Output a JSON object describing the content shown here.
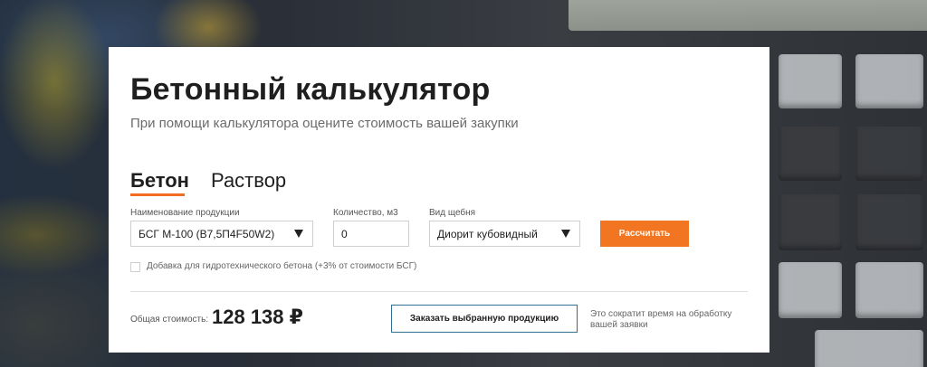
{
  "page": {
    "title": "Бетонный калькулятор",
    "subtitle": "При помощи калькулятора оцените стоимость вашей закупки"
  },
  "tabs": [
    {
      "label": "Бетон",
      "active": true
    },
    {
      "label": "Раствор",
      "active": false
    }
  ],
  "form": {
    "product": {
      "label": "Наименование продукции",
      "value": "БСГ М-100 (В7,5П4F50W2)"
    },
    "quantity": {
      "label": "Количество, м3",
      "value": "0"
    },
    "gravel": {
      "label": "Вид щебня",
      "value": "Диорит кубовидный"
    },
    "calculate_label": "Рассчитать",
    "additive": {
      "label": "Добавка для гидротехнического бетона (+3% от стоимости БСГ)",
      "checked": false
    }
  },
  "summary": {
    "total_label": "Общая стоимость:",
    "total_value": "128 138 ₽",
    "order_label": "Заказать выбранную продукцию",
    "hint": "Это сократит время на обработку вашей заявки"
  },
  "colors": {
    "accent": "#f27522",
    "order_border": "#2f6f8f"
  },
  "icons": {
    "select_caret": "triangle-down"
  }
}
